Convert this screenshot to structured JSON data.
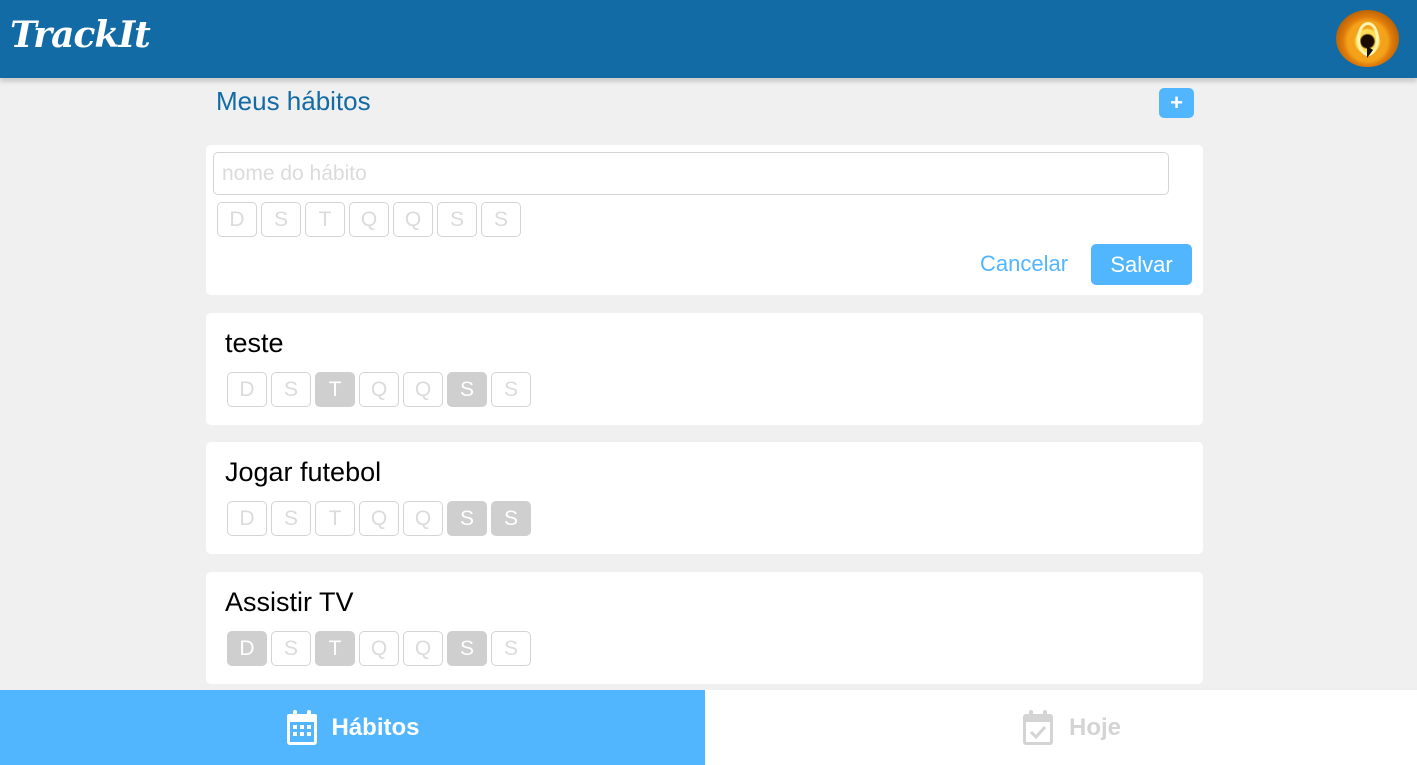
{
  "header": {
    "logo": "TrackIt"
  },
  "main": {
    "title": "Meus hábitos",
    "add_label": "+",
    "new_habit": {
      "placeholder": "nome do hábito",
      "weekdays": [
        "D",
        "S",
        "T",
        "Q",
        "Q",
        "S",
        "S"
      ],
      "cancel_label": "Cancelar",
      "save_label": "Salvar"
    },
    "habits": [
      {
        "name": "teste",
        "selected_days": [
          2,
          5
        ]
      },
      {
        "name": "Jogar futebol",
        "selected_days": [
          5,
          6
        ]
      },
      {
        "name": "Assistir TV",
        "selected_days": [
          0,
          2,
          5
        ]
      }
    ]
  },
  "footer": {
    "tab_habits": "Hábitos",
    "tab_today": "Hoje"
  },
  "colors": {
    "header": "#126ba5",
    "accent": "#52b6ff",
    "selected_day": "#cfcfcf",
    "disabled": "#dbdbdb"
  },
  "icons": {
    "tab_habits": "calendar-icon",
    "tab_today": "calendar-check-icon"
  }
}
